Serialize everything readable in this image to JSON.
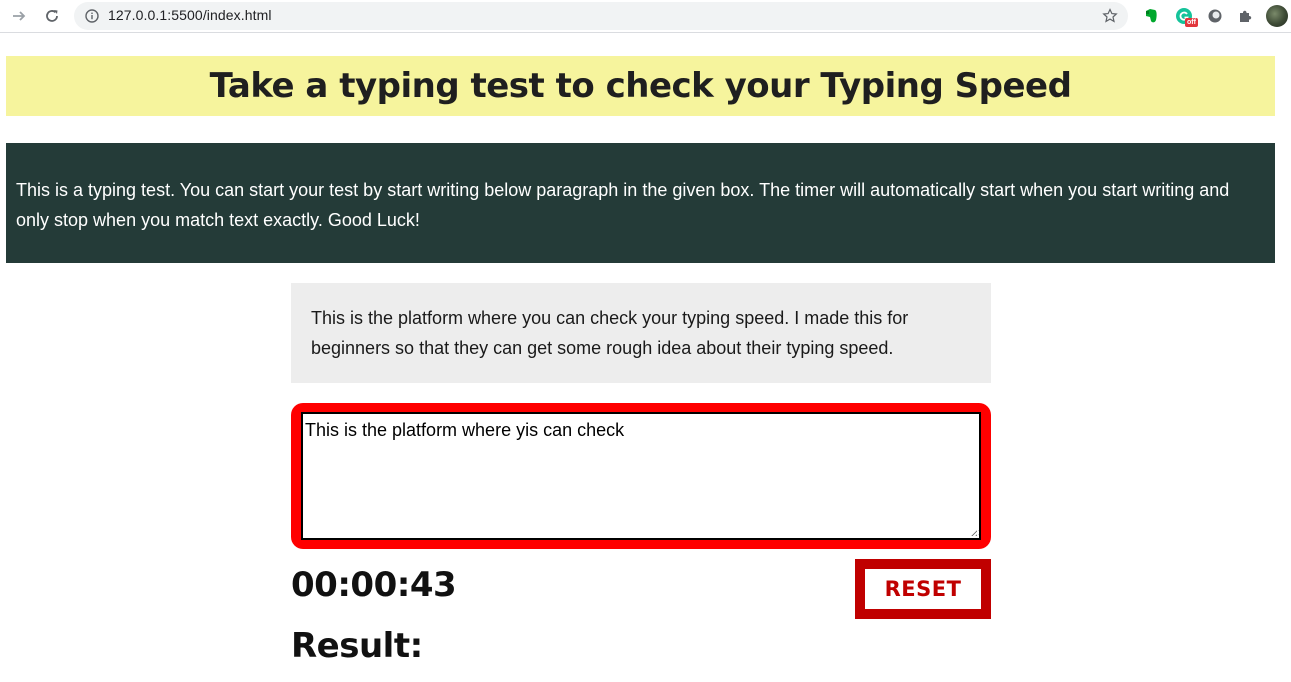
{
  "browser": {
    "url": "127.0.0.1:5500/index.html",
    "extension_badge": "off",
    "icons": {
      "forward": "forward-arrow-icon",
      "reload": "reload-icon",
      "info": "info-icon",
      "bookmark": "star-icon",
      "extensions": [
        "evernote-icon",
        "grammarly-icon",
        "circle-extension-icon",
        "puzzle-icon",
        "profile-avatar"
      ]
    }
  },
  "page": {
    "title": "Take a typing test to check your Typing Speed",
    "intro": "This is a typing test. You can start your test by start writing below paragraph in the given box. The timer will automatically start when you start writing and only stop when you match text exactly. Good Luck!",
    "sample_text": "This is the platform where you can check your typing speed. I made this for beginners so that they can get some rough idea about their typing speed.",
    "input_value": "This is the platform where yis can check",
    "timer": "00:00:43",
    "reset_label": "RESET",
    "result_label": "Result:"
  },
  "colors": {
    "header_bg": "#f6f49d",
    "intro_bg": "#243b38",
    "sample_bg": "#ededed",
    "input_border": "#ff0000",
    "reset_accent": "#c00000"
  }
}
